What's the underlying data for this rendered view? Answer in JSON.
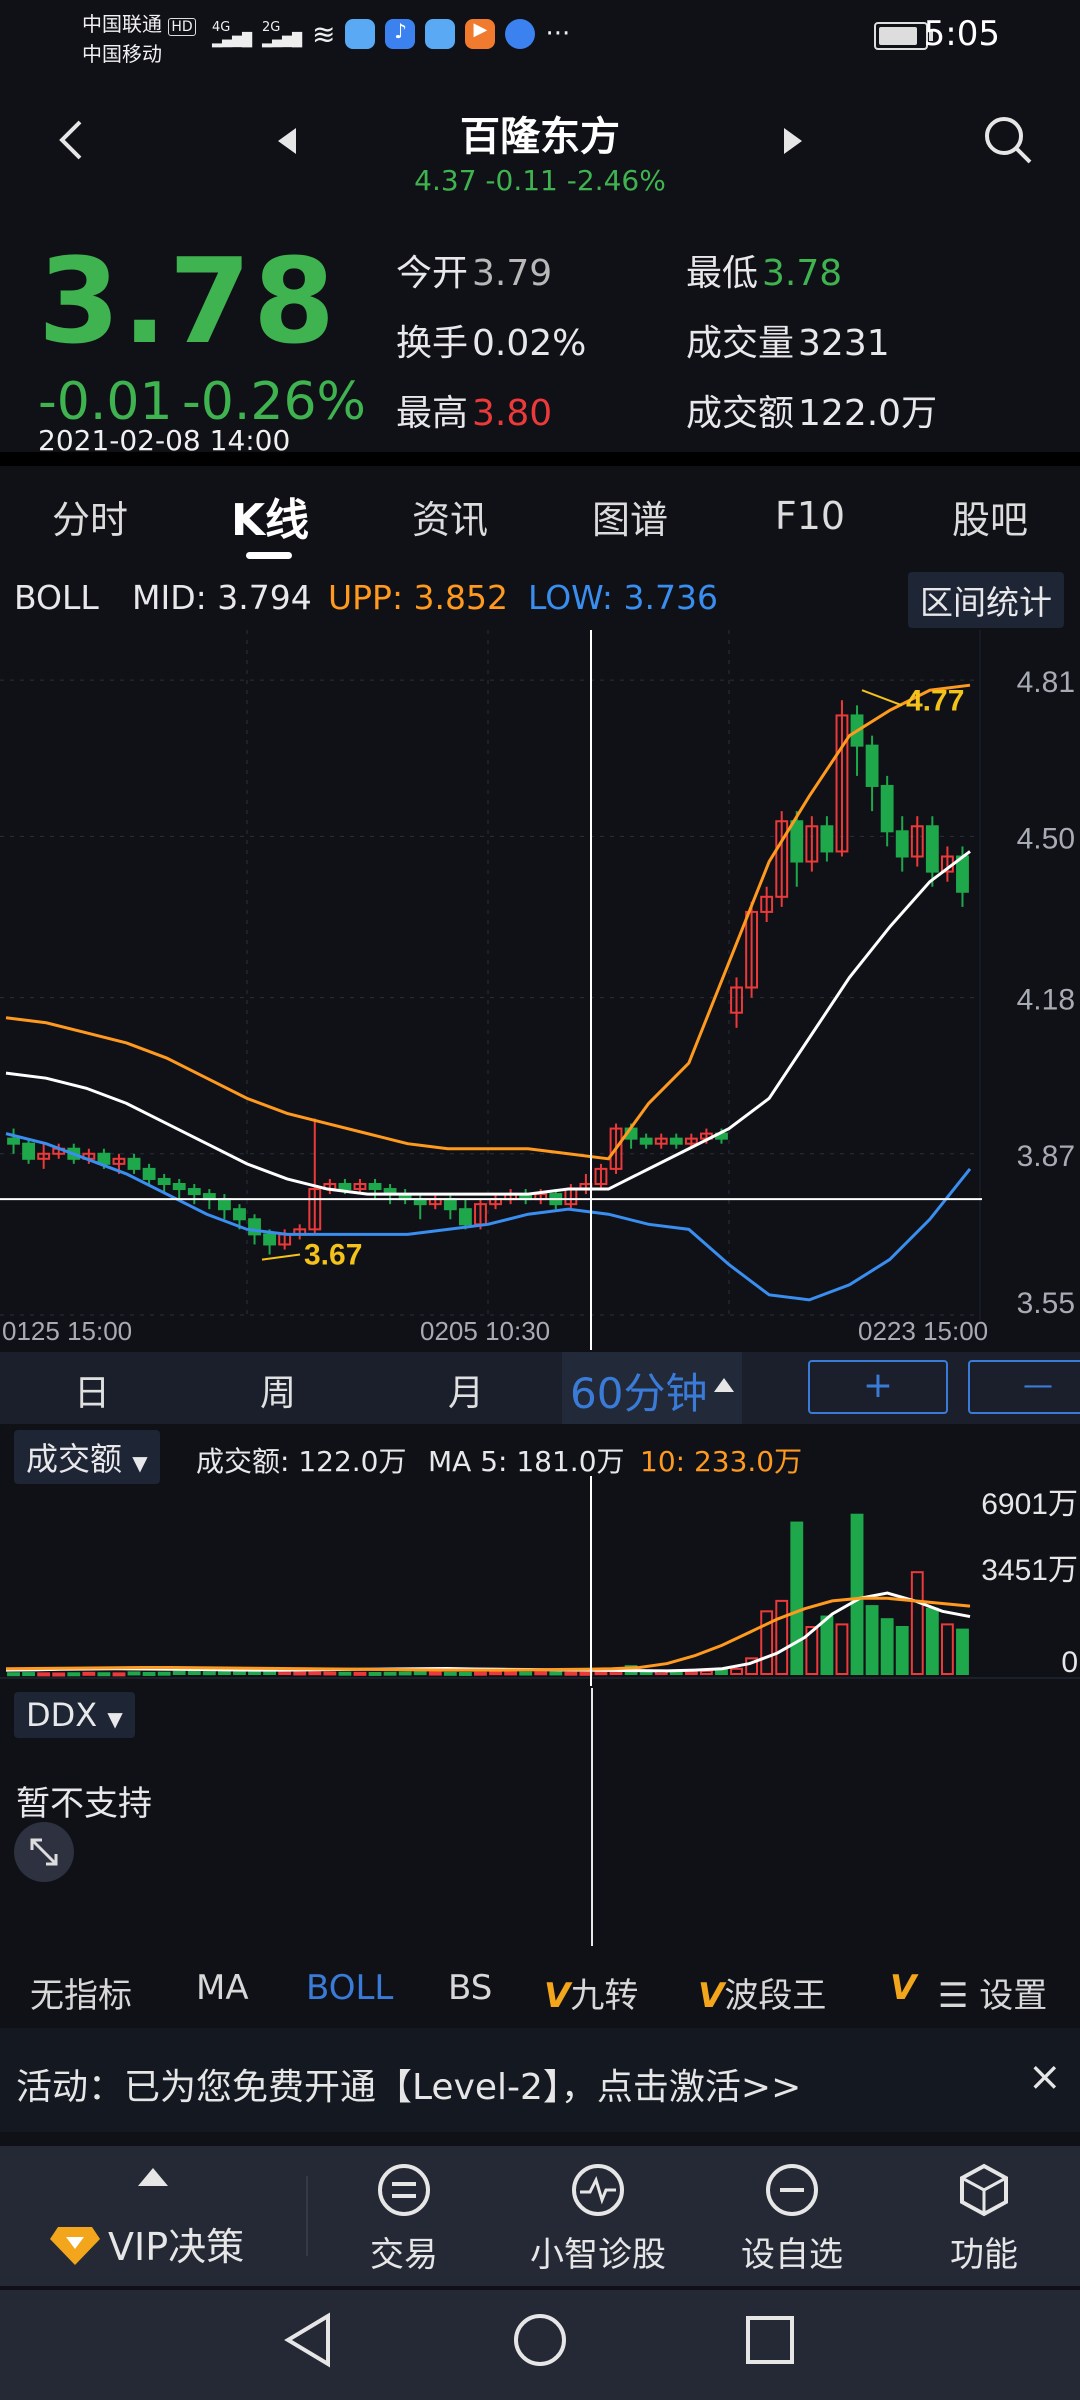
{
  "status_bar": {
    "carrier1": "中国联通",
    "carrier1_badge": "HD",
    "carrier2": "中国移动",
    "net1": "4G",
    "net2": "2G",
    "more": "···",
    "time": "5:05"
  },
  "header": {
    "title": "百隆东方",
    "subtitle": "4.37  -0.11  -2.46%"
  },
  "quote": {
    "price": "3.78",
    "change": "-0.01",
    "change_pct": "-0.26%",
    "datetime": "2021-02-08  14:00",
    "open_label": "今开",
    "open_value": "3.79",
    "low_label": "最低",
    "low_value": "3.78",
    "turnover_label": "换手",
    "turnover_value": "0.02%",
    "volume_label": "成交量",
    "volume_value": "3231",
    "high_label": "最高",
    "high_value": "3.80",
    "amount_label": "成交额",
    "amount_value": "122.0万"
  },
  "tabs": [
    "分时",
    "K线",
    "资讯",
    "图谱",
    "F10",
    "股吧"
  ],
  "boll": {
    "name": "BOLL",
    "mid": "MID: 3.794",
    "upp": "UPP: 3.852",
    "low": "LOW: 3.736",
    "range_stats": "区间统计"
  },
  "chart_data": {
    "type": "candlestick",
    "indicator": "BOLL",
    "y_ticks": [
      "4.81",
      "4.50",
      "4.18",
      "3.87",
      "3.55"
    ],
    "ylim": [
      3.55,
      4.81
    ],
    "x_ticks": [
      "0125  15:00",
      "0205  10:30",
      "0223  15:00"
    ],
    "annotations": [
      {
        "label": "4.77",
        "value": 4.77
      },
      {
        "label": "3.67",
        "value": 3.67
      }
    ],
    "crosshair_value": 3.78,
    "candles": [
      [
        3.9,
        3.89,
        3.92,
        3.87
      ],
      [
        3.89,
        3.86,
        3.9,
        3.85
      ],
      [
        3.86,
        3.87,
        3.89,
        3.84
      ],
      [
        3.87,
        3.88,
        3.89,
        3.86
      ],
      [
        3.88,
        3.86,
        3.89,
        3.85
      ],
      [
        3.86,
        3.87,
        3.88,
        3.85
      ],
      [
        3.87,
        3.85,
        3.88,
        3.84
      ],
      [
        3.85,
        3.86,
        3.87,
        3.83
      ],
      [
        3.86,
        3.84,
        3.87,
        3.83
      ],
      [
        3.84,
        3.82,
        3.85,
        3.81
      ],
      [
        3.82,
        3.81,
        3.83,
        3.79
      ],
      [
        3.81,
        3.8,
        3.82,
        3.78
      ],
      [
        3.8,
        3.79,
        3.81,
        3.77
      ],
      [
        3.79,
        3.78,
        3.8,
        3.76
      ],
      [
        3.78,
        3.76,
        3.79,
        3.74
      ],
      [
        3.76,
        3.74,
        3.77,
        3.72
      ],
      [
        3.74,
        3.71,
        3.75,
        3.69
      ],
      [
        3.71,
        3.69,
        3.72,
        3.67
      ],
      [
        3.69,
        3.71,
        3.72,
        3.68
      ],
      [
        3.71,
        3.72,
        3.73,
        3.7
      ],
      [
        3.72,
        3.8,
        3.94,
        3.71
      ],
      [
        3.8,
        3.81,
        3.82,
        3.79
      ],
      [
        3.81,
        3.8,
        3.82,
        3.79
      ],
      [
        3.8,
        3.81,
        3.82,
        3.79
      ],
      [
        3.81,
        3.8,
        3.82,
        3.78
      ],
      [
        3.8,
        3.79,
        3.81,
        3.77
      ],
      [
        3.79,
        3.78,
        3.8,
        3.77
      ],
      [
        3.78,
        3.77,
        3.79,
        3.74
      ],
      [
        3.77,
        3.78,
        3.79,
        3.76
      ],
      [
        3.78,
        3.76,
        3.79,
        3.74
      ],
      [
        3.76,
        3.73,
        3.78,
        3.72
      ],
      [
        3.73,
        3.77,
        3.78,
        3.72
      ],
      [
        3.77,
        3.78,
        3.79,
        3.76
      ],
      [
        3.78,
        3.79,
        3.8,
        3.77
      ],
      [
        3.79,
        3.78,
        3.8,
        3.77
      ],
      [
        3.78,
        3.79,
        3.8,
        3.77
      ],
      [
        3.79,
        3.77,
        3.8,
        3.76
      ],
      [
        3.77,
        3.8,
        3.81,
        3.76
      ],
      [
        3.8,
        3.81,
        3.83,
        3.79
      ],
      [
        3.81,
        3.84,
        3.85,
        3.8
      ],
      [
        3.84,
        3.92,
        3.93,
        3.83
      ],
      [
        3.92,
        3.9,
        3.93,
        3.88
      ],
      [
        3.9,
        3.89,
        3.91,
        3.88
      ],
      [
        3.89,
        3.9,
        3.91,
        3.88
      ],
      [
        3.9,
        3.89,
        3.91,
        3.88
      ],
      [
        3.89,
        3.9,
        3.91,
        3.88
      ],
      [
        3.9,
        3.91,
        3.92,
        3.89
      ],
      [
        3.91,
        3.9,
        3.92,
        3.89
      ],
      [
        4.15,
        4.2,
        4.22,
        4.12
      ],
      [
        4.2,
        4.35,
        4.37,
        4.18
      ],
      [
        4.35,
        4.38,
        4.4,
        4.33
      ],
      [
        4.38,
        4.53,
        4.55,
        4.36
      ],
      [
        4.53,
        4.45,
        4.55,
        4.4
      ],
      [
        4.45,
        4.52,
        4.54,
        4.43
      ],
      [
        4.52,
        4.47,
        4.54,
        4.45
      ],
      [
        4.47,
        4.74,
        4.77,
        4.46
      ],
      [
        4.74,
        4.68,
        4.76,
        4.62
      ],
      [
        4.68,
        4.6,
        4.7,
        4.55
      ],
      [
        4.6,
        4.51,
        4.62,
        4.48
      ],
      [
        4.51,
        4.46,
        4.54,
        4.43
      ],
      [
        4.46,
        4.52,
        4.54,
        4.44
      ],
      [
        4.52,
        4.43,
        4.54,
        4.4
      ],
      [
        4.43,
        4.46,
        4.48,
        4.41
      ],
      [
        4.46,
        4.39,
        4.48,
        4.36
      ]
    ],
    "boll_upper": [
      4.14,
      4.13,
      4.11,
      4.09,
      4.06,
      4.02,
      3.98,
      3.95,
      3.93,
      3.91,
      3.89,
      3.88,
      3.88,
      3.88,
      3.87,
      3.86,
      3.97,
      4.05,
      4.25,
      4.45,
      4.58,
      4.7,
      4.75,
      4.79,
      4.8
    ],
    "boll_mid": [
      4.03,
      4.02,
      4.0,
      3.97,
      3.93,
      3.89,
      3.85,
      3.82,
      3.8,
      3.79,
      3.79,
      3.79,
      3.79,
      3.79,
      3.8,
      3.8,
      3.84,
      3.88,
      3.92,
      3.98,
      4.1,
      4.22,
      4.32,
      4.41,
      4.47
    ],
    "boll_lower": [
      3.91,
      3.89,
      3.86,
      3.83,
      3.79,
      3.75,
      3.72,
      3.71,
      3.71,
      3.71,
      3.71,
      3.72,
      3.73,
      3.75,
      3.76,
      3.75,
      3.73,
      3.72,
      3.65,
      3.59,
      3.58,
      3.61,
      3.66,
      3.74,
      3.84
    ]
  },
  "timeframes": [
    "日",
    "周",
    "月",
    "60分钟"
  ],
  "zoom": {
    "plus": "+",
    "minus": "—"
  },
  "volume": {
    "selector": "成交额",
    "amount": "成交额: 122.0万",
    "ma5": "MA 5: 181.0万",
    "ma10": "10: 233.0万",
    "y_ticks": [
      "6901万",
      "3451万",
      "0"
    ],
    "max": 6901,
    "bars": [
      30,
      35,
      25,
      20,
      28,
      45,
      30,
      25,
      60,
      40,
      50,
      80,
      90,
      70,
      120,
      200,
      150,
      90,
      80,
      60,
      70,
      60,
      50,
      45,
      40,
      50,
      60,
      70,
      55,
      45,
      40,
      50,
      70,
      60,
      55,
      65,
      60,
      50,
      45,
      70,
      80,
      300,
      120,
      90,
      100,
      80,
      110,
      150,
      200,
      600,
      2400,
      2800,
      5800,
      1800,
      2200,
      1900,
      6100,
      2600,
      2100,
      1800,
      3900,
      2500,
      1900,
      1700
    ],
    "ma_white": [
      150,
      160,
      180,
      190,
      200,
      190,
      180,
      170,
      160,
      150,
      150,
      160,
      170,
      180,
      190,
      200,
      210,
      190,
      180,
      170,
      160,
      150,
      140,
      130,
      120,
      150,
      200,
      400,
      800,
      1400,
      2300,
      2900,
      3100,
      2800,
      2400,
      2200
    ],
    "ma_orange": [
      200,
      210,
      220,
      230,
      240,
      250,
      250,
      240,
      230,
      220,
      210,
      200,
      190,
      180,
      170,
      160,
      150,
      150,
      150,
      160,
      170,
      180,
      200,
      250,
      400,
      700,
      1100,
      1600,
      2100,
      2500,
      2800,
      2900,
      2900,
      2800,
      2700,
      2600
    ]
  },
  "ddx": {
    "selector": "DDX",
    "message": "暂不支持"
  },
  "indicators": [
    "无指标",
    "MA",
    "BOLL",
    "BS",
    "九转",
    "波段王"
  ],
  "indicator_v": "V",
  "settings": "设置",
  "banner": {
    "text": "活动：已为您免费开通【Level-2】，点击激活>>",
    "close": "×"
  },
  "bottom_nav": [
    {
      "label": "VIP决策"
    },
    {
      "label": "交易"
    },
    {
      "label": "小智诊股"
    },
    {
      "label": "设自选"
    },
    {
      "label": "功能"
    }
  ],
  "colors": {
    "up": "#ec3a3a",
    "down": "#1ea84b",
    "mid": "#ffffff",
    "upper": "#ff9a1f",
    "lower": "#3a8ef0",
    "accent": "#3b7bd8",
    "yellow": "#f3c21b"
  }
}
